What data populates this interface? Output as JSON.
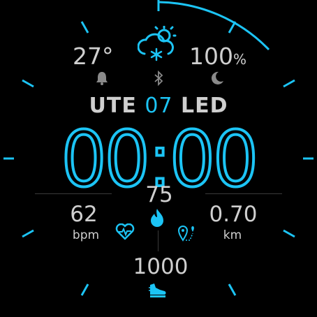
{
  "accent": "#1cc4f5",
  "text_color": "#cfcfcf",
  "weather": {
    "temperature": "27°",
    "humidity_value": "100",
    "humidity_unit": "%",
    "icon": "snow-cloud-sun-icon"
  },
  "status_icons": [
    "alarm-bell-icon",
    "bluetooth-icon",
    "moon-icon"
  ],
  "date": {
    "weekday": "UTE",
    "day": "07",
    "month": "LED"
  },
  "time": "00:00",
  "stats": {
    "calories": "75",
    "heart_rate": "62",
    "heart_rate_unit": "bpm",
    "distance": "0.70",
    "distance_unit": "km",
    "steps": "1000"
  },
  "battery_arc_level": 0.1
}
